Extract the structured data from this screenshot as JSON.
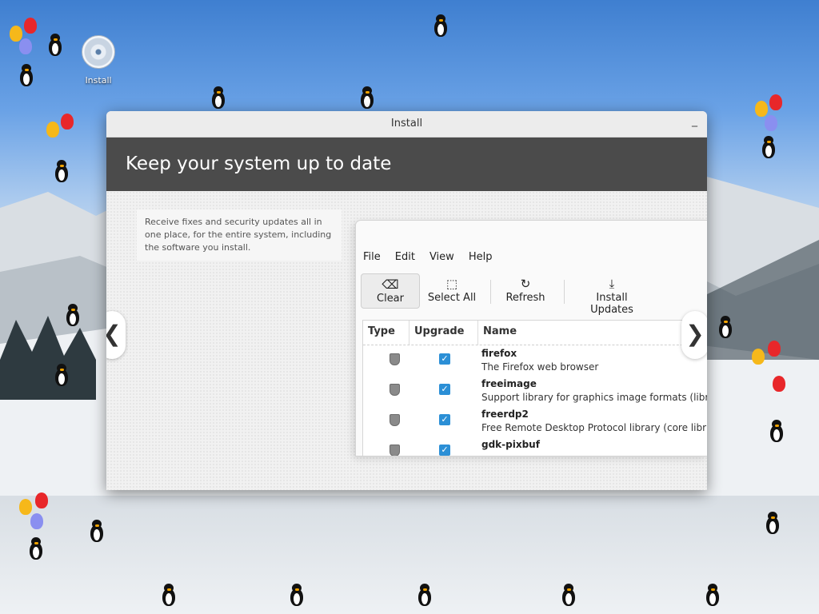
{
  "desktop": {
    "icon_label": "Install"
  },
  "window": {
    "title": "Install",
    "minimize_glyph": "_",
    "heading": "Keep your system up to date",
    "description": "Receive fixes and security updates all in one place, for the entire system, including the software you install.",
    "prev_glyph": "❮",
    "next_glyph": "❯"
  },
  "update_manager": {
    "menu": [
      "File",
      "Edit",
      "View",
      "Help"
    ],
    "toolbar": {
      "clear": "Clear",
      "select_all": "Select All",
      "refresh": "Refresh",
      "install_updates": "Install Updates"
    },
    "columns": {
      "type": "Type",
      "upgrade": "Upgrade",
      "name": "Name"
    },
    "rows": [
      {
        "name": "firefox",
        "desc": "The Firefox web browser"
      },
      {
        "name": "freeimage",
        "desc": "Support library for graphics image formats (libr"
      },
      {
        "name": "freerdp2",
        "desc": "Free Remote Desktop Protocol library (core libr"
      },
      {
        "name": "gdk-pixbuf",
        "desc": ""
      }
    ]
  },
  "colors": {
    "accent": "#2b8fd6",
    "banner": "#4b4b4b"
  }
}
